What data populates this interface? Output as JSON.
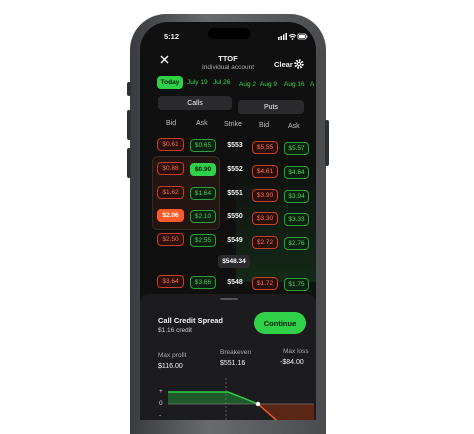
{
  "status": {
    "time": "5:12"
  },
  "header": {
    "title": "TTOF",
    "subtitle": "Individual account",
    "clear_label": "Clear"
  },
  "dates": [
    "Today",
    "July 19",
    "Jul 26",
    "Aug 2",
    "Aug 9",
    "Aug 16",
    "A"
  ],
  "tabs": {
    "calls": "Calls",
    "puts": "Puts"
  },
  "columns": {
    "bid": "Bid",
    "ask": "Ask",
    "strike": "Strike",
    "put_bid": "Bid",
    "put_ask": "Ask"
  },
  "rows": [
    {
      "call_bid": "$0.61",
      "call_ask": "$0.65",
      "strike": "$553",
      "put_bid": "$5.55",
      "put_ask": "$5.57"
    },
    {
      "call_bid": "$0.88",
      "call_ask": "$0.90",
      "strike": "$552",
      "put_bid": "$4.61",
      "put_ask": "$4.64"
    },
    {
      "call_bid": "$1.62",
      "call_ask": "$1.64",
      "strike": "$551",
      "put_bid": "$3.90",
      "put_ask": "$3.94"
    },
    {
      "call_bid": "$2.06",
      "call_ask": "$2.10",
      "strike": "$550",
      "put_bid": "$3.30",
      "put_ask": "$3.33"
    },
    {
      "call_bid": "$2.50",
      "call_ask": "$2.55",
      "strike": "$549",
      "put_bid": "$2.72",
      "put_ask": "$2.76"
    }
  ],
  "price_marker": "$548.34",
  "row_last": {
    "call_bid": "$3.64",
    "call_ask": "$3.66",
    "strike": "$548",
    "put_bid": "$1.72",
    "put_ask": "$1.75"
  },
  "sheet": {
    "title": "Call Credit Spread",
    "credit": "$1.16 credit",
    "continue_label": "Continue",
    "max_profit_label": "Max profit",
    "max_profit_value": "$116.00",
    "breakeven_label": "Breakeven",
    "breakeven_value": "$551.16",
    "max_loss_label": "Max loss",
    "max_loss_value": "-$84.00",
    "chart_axis": [
      "+",
      "0",
      "-"
    ]
  },
  "colors": {
    "accent_green": "#2ed147",
    "accent_red": "#ff5a2a",
    "background": "#101010"
  }
}
